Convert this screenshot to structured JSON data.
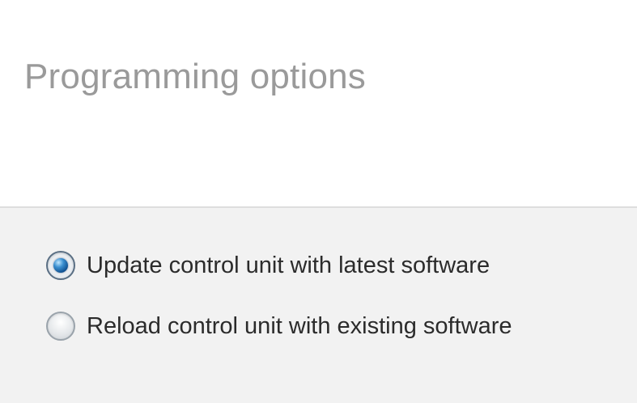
{
  "header": {
    "title": "Programming options"
  },
  "options": [
    {
      "label": "Update control unit with latest software",
      "selected": true
    },
    {
      "label": "Reload control unit with existing software",
      "selected": false
    }
  ],
  "colors": {
    "title": "#9a9a9a",
    "panel_background": "#f2f2f2",
    "radio_selected": "#1a5fa0",
    "label_text": "#2b2b2b"
  }
}
